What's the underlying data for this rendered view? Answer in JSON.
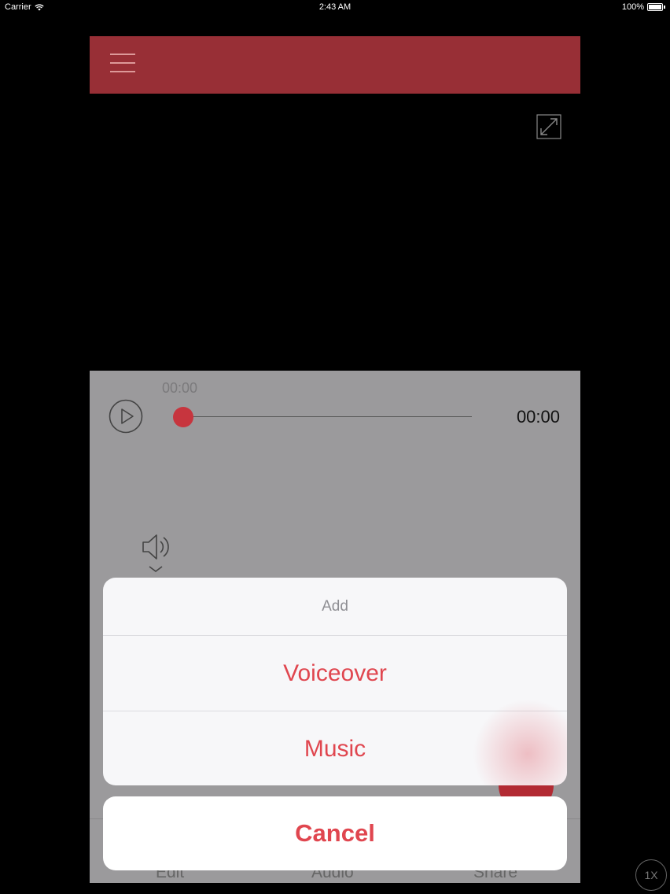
{
  "status_bar": {
    "carrier": "Carrier",
    "time": "2:43 AM",
    "battery": "100%"
  },
  "player": {
    "elapsed": "00:00",
    "duration": "00:00",
    "progress": 0
  },
  "tabs": [
    "Edit",
    "Audio",
    "Share"
  ],
  "action_sheet": {
    "title": "Add",
    "options": [
      "Voiceover",
      "Music"
    ],
    "cancel": "Cancel"
  },
  "speed_label": "1X",
  "colors": {
    "accent": "#982f36",
    "sheet_text": "#e0464f",
    "thumb": "#c7353e"
  },
  "icons": [
    "menu-icon",
    "expand-icon",
    "play-icon",
    "speaker-icon",
    "chevron-down-icon"
  ]
}
